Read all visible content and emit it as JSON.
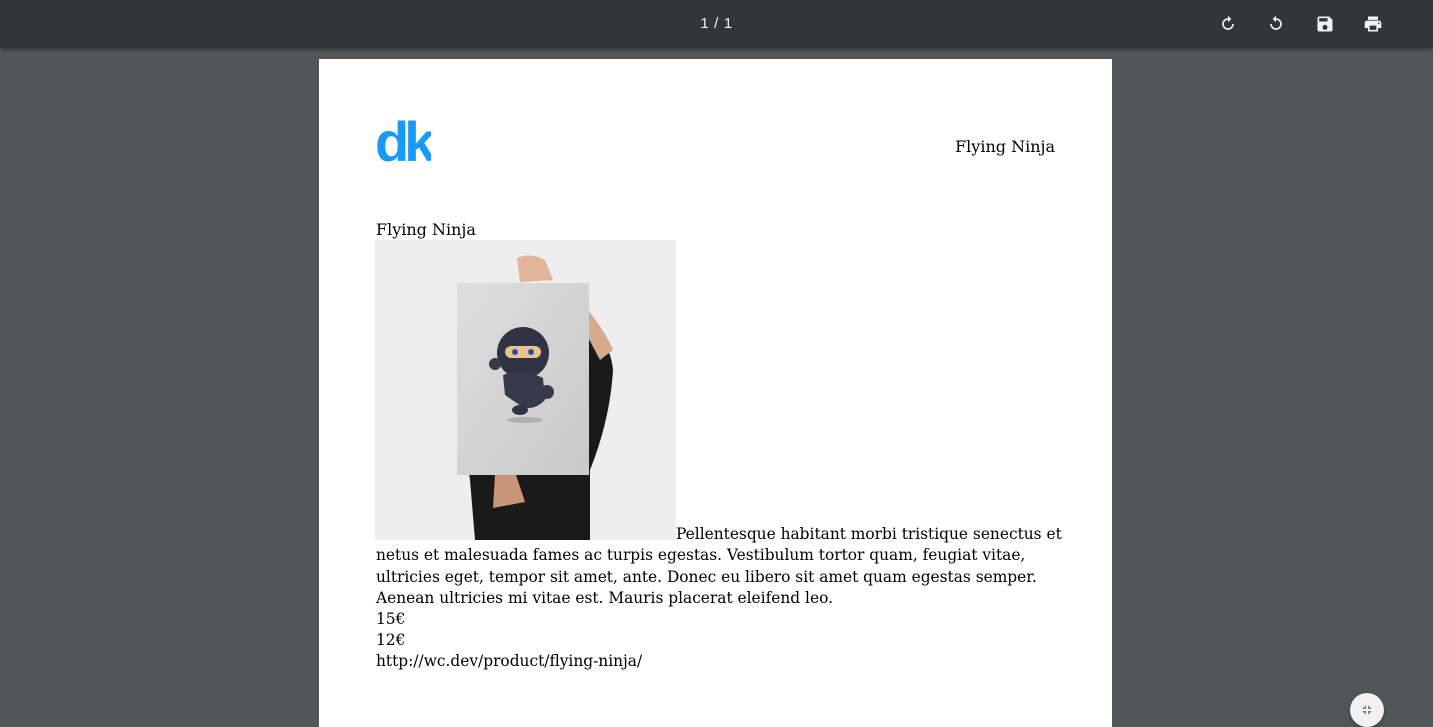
{
  "toolbar": {
    "current_page": "1",
    "separator": "/",
    "total_pages": "1",
    "rotate_clockwise_icon": "rotate-clockwise-icon",
    "rotate_counterclockwise_icon": "rotate-counterclockwise-icon",
    "save_icon": "save-icon",
    "print_icon": "print-icon"
  },
  "document": {
    "logo_text": "dk",
    "logo_color": "#1a9af7",
    "header_title": "Flying Ninja",
    "product_name": "Flying Ninja",
    "description": "Pellentesque habitant morbi tristique senectus et netus et malesuada fames ac turpis egestas. Vestibulum tortor quam, feugiat vitae, ultricies eget, tempor sit amet, ante. Donec eu libero sit amet quam egestas semper. Aenean ultricies mi vitae est. Mauris placerat eleifend leo.",
    "regular_price": "15€",
    "sale_price": "12€",
    "product_url": "http://wc.dev/product/flying-ninja/"
  },
  "colors": {
    "toolbar_bg": "#323639",
    "viewer_bg": "#525659",
    "page_bg": "#ffffff"
  },
  "fit_button_icon": "fit-to-page-icon"
}
